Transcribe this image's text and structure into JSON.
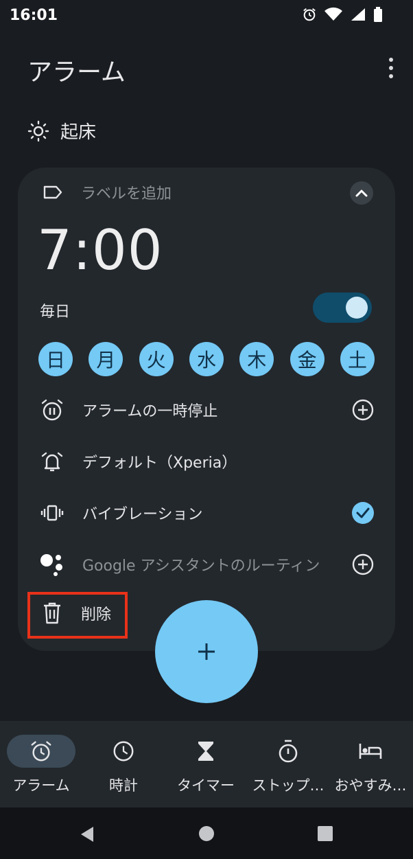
{
  "status_bar": {
    "time": "16:01"
  },
  "header": {
    "title": "アラーム"
  },
  "section": {
    "label": "起床"
  },
  "alarm": {
    "label_placeholder": "ラベルを追加",
    "time": "7:00",
    "repeat": "毎日",
    "enabled": true,
    "days": [
      "日",
      "月",
      "火",
      "水",
      "木",
      "金",
      "土"
    ],
    "options": {
      "pause": "アラームの一時停止",
      "sound": "デフォルト（Xperia）",
      "vibration": "バイブレーション",
      "assistant": "Google アシスタントのルーティン"
    },
    "delete": "削除"
  },
  "fab": {
    "symbol": "+"
  },
  "bottom_nav": {
    "alarm": "アラーム",
    "clock": "時計",
    "timer": "タイマー",
    "stopwatch": "ストップ…",
    "bedtime": "おやすみ…"
  },
  "colors": {
    "accent": "#74c9f5",
    "background": "#191c20",
    "card": "#23282d",
    "highlight": "#e8321a"
  }
}
